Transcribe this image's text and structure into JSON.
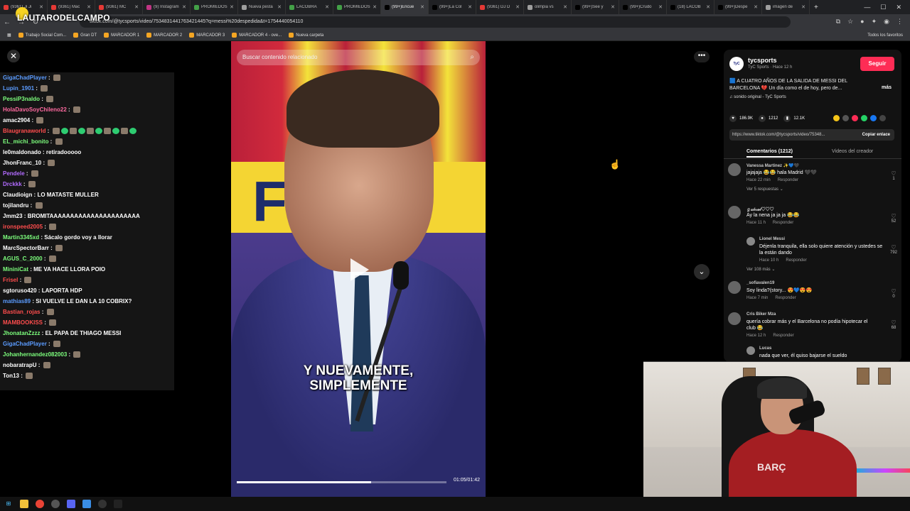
{
  "browser": {
    "tabs": [
      {
        "title": "(9361) Ji Ji",
        "color": "#e53935"
      },
      {
        "title": "(9361) Mac",
        "color": "#e53935"
      },
      {
        "title": "(9361) MC",
        "color": "#e53935"
      },
      {
        "title": "(9) Instagram",
        "color": "#c13584"
      },
      {
        "title": "PROMIEDOS",
        "color": "#43a047"
      },
      {
        "title": "Nueva pesta",
        "color": "#9e9e9e"
      },
      {
        "title": "LACOBRA",
        "color": "#43a047"
      },
      {
        "title": "PROMIEDOS",
        "color": "#43a047"
      },
      {
        "title": "(99+)Encue",
        "color": "#000000"
      },
      {
        "title": "(99+)La Col",
        "color": "#000000"
      },
      {
        "title": "(9361) DJ D",
        "color": "#e53935"
      },
      {
        "title": "olimpia vs",
        "color": "#9e9e9e"
      },
      {
        "title": "(99+)See y",
        "color": "#000000"
      },
      {
        "title": "(99+)Crudo",
        "color": "#000000"
      },
      {
        "title": "(18) LACOB",
        "color": "#000000"
      },
      {
        "title": "(99+)Despe",
        "color": "#000000"
      },
      {
        "title": "imagen de",
        "color": "#9e9e9e"
      }
    ],
    "active_tab_index": 8,
    "url": "tiktok.com/@tycsports/video/7534831441763421445?q=messi%20despedida&t=1754440054110",
    "bookmarks": [
      "Trabajo Social Com...",
      "Gran DT",
      "MARCADOR 1",
      "MARCADOR 2",
      "MARCADOR 3",
      "MARCADOR 4 - ove...",
      "Nueva carpeta"
    ],
    "bookmarks_right": "Todos los favoritos",
    "overlay_logo": "LAUTARODELCAMPO"
  },
  "chat": {
    "messages": [
      {
        "user": "GigaChadPlayer",
        "color": "#5b9cff",
        "text": "",
        "emotes": 1
      },
      {
        "user": "Lupin_1901",
        "color": "#5b9cff",
        "text": "",
        "emotes": 1
      },
      {
        "user": "PessiP3naldo",
        "color": "#7dff7d",
        "text": "",
        "emotes": 1
      },
      {
        "user": "HolaDavoSoyChileno22",
        "color": "#ff6aa0",
        "text": "",
        "emotes": 1
      },
      {
        "user": "amac2904",
        "color": "#ffffff",
        "text": "",
        "emotes": 1
      },
      {
        "user": "Blaugranaworld",
        "color": "#ff4d4d",
        "text": "",
        "emotes": 10
      },
      {
        "user": "EL_michi_bonito",
        "color": "#7dff7d",
        "text": "",
        "emotes": 1
      },
      {
        "user": "le0maldonado",
        "color": "#ffffff",
        "text": "retiradooooo",
        "emotes": 0
      },
      {
        "user": "JhonFranc_10",
        "color": "#ffffff",
        "text": "",
        "emotes": 1
      },
      {
        "user": "Pendele",
        "color": "#b26bff",
        "text": "",
        "emotes": 1
      },
      {
        "user": "Drckkk",
        "color": "#b26bff",
        "text": "",
        "emotes": 1
      },
      {
        "user": "Claudioign",
        "color": "#ffffff",
        "text": "LO MATASTE MULLER",
        "emotes": 0
      },
      {
        "user": "tojilandru",
        "color": "#ffffff",
        "text": "",
        "emotes": 1
      },
      {
        "user": "Jmm23",
        "color": "#ffffff",
        "text": "BROMITAAAAAAAAAAAAAAAAAAAAAA",
        "emotes": 0
      },
      {
        "user": "ironspeed2005",
        "color": "#ff4d4d",
        "text": "",
        "emotes": 1
      },
      {
        "user": "Martin3345xd",
        "color": "#7dff7d",
        "text": "Sácalo gordo voy a llorar",
        "emotes": 0
      },
      {
        "user": "MarcSpectorBarr",
        "color": "#ffffff",
        "text": "",
        "emotes": 1
      },
      {
        "user": "AGUS_C_2000",
        "color": "#7dff7d",
        "text": "",
        "emotes": 1
      },
      {
        "user": "MininiCat",
        "color": "#7dff7d",
        "text": "ME VA HACE LLORA POIO",
        "emotes": 0
      },
      {
        "user": "Frisel",
        "color": "#ff4d4d",
        "text": "",
        "emotes": 1
      },
      {
        "user": "sgtoruso420",
        "color": "#ffffff",
        "text": "LAPORTA HDP",
        "emotes": 0
      },
      {
        "user": "mathias89",
        "color": "#5b9cff",
        "text": "SI VUELVE LE DAN LA 10 COBRIX?",
        "emotes": 0
      },
      {
        "user": "Bastian_rojas",
        "color": "#ff4d4d",
        "text": "",
        "emotes": 1
      },
      {
        "user": "MAMBOOKISS",
        "color": "#ff4d4d",
        "text": "",
        "emotes": 1
      },
      {
        "user": "JhonatanZzzz",
        "color": "#7dff7d",
        "text": "EL PAPA DE THIAGO MESSI",
        "emotes": 0
      },
      {
        "user": "GigaChadPlayer",
        "color": "#5b9cff",
        "text": "",
        "emotes": 1
      },
      {
        "user": "Johanhernandez082003",
        "color": "#7dff7d",
        "text": "",
        "emotes": 1
      },
      {
        "user": "nobaratrapU",
        "color": "#ffffff",
        "text": "",
        "emotes": 1
      },
      {
        "user": "Ton13",
        "color": "#ffffff",
        "text": "",
        "emotes": 1
      }
    ]
  },
  "video": {
    "search_placeholder": "Buscar contenido relacionado",
    "subtitle_line1": "Y NUEVAMENTE,",
    "subtitle_line2": "SIMPLEMENTE",
    "time": "01:05/01:42",
    "progress": 0.64,
    "bg_letter": "F"
  },
  "panel": {
    "account_name": "tycsports",
    "account_sub": "TyC Sports · Hace 12 h",
    "follow_label": "Seguir",
    "description": "🟦 A CUATRO AÑOS DE LA SALIDA DE MESSI DEL BARCELONA 💔 Un día como el de hoy, pero de...",
    "more_label": "más",
    "sound": "♫ sonido original - TyC Sports",
    "likes": "186.9K",
    "comments": "1212",
    "saves": "12.1K",
    "link": "https://www.tiktok.com/@tycsports/video/75348...",
    "copy_label": "Copiar enlace",
    "tab_comments": "Comentarios (1212)",
    "tab_creator": "Videos del creador",
    "comment_list": [
      {
        "name": "Vanessa Martinez ✨💙🖤",
        "text": "jajajaja 😂😂 hala Madrid 🖤🖤",
        "time": "Hace 22 min",
        "reply": "Responder",
        "likes": "1",
        "replies": "Ver 5 respuestas ⌄"
      },
      {
        "name": "ℊ𝒶𝒷𝓇𝒾ℯ𝓁♡♡♡",
        "text": "Ay la nena ja ja ja 😂😂",
        "time": "Hace 11 h",
        "reply": "Responder",
        "likes": "52",
        "replies": ""
      },
      {
        "name": "Lionel Messi",
        "text": "Déjenla tranquila, ella solo quiere atención y ustedes se la están dando",
        "time": "Hace 10 h",
        "reply": "Responder",
        "likes": "792",
        "replies": "Ver 108 más ⌄"
      },
      {
        "name": "_sofiavalen19",
        "text": "Soy linda?(story... 😍💙😍😍",
        "time": "Hace 7 min",
        "reply": "Responder",
        "likes": "0",
        "replies": ""
      },
      {
        "name": "Cris Biker Mza",
        "text": "quería cobrar más y el Barcelona no podía hipotecar el club 😂",
        "time": "Hace 12 h",
        "reply": "Responder",
        "likes": "68",
        "replies": ""
      },
      {
        "name": "Lucas",
        "text": "nada que ver, él quiso bajarse el sueldo",
        "time": "",
        "reply": "",
        "likes": "",
        "replies": ""
      }
    ]
  },
  "webcam": {
    "shirt_text": "BARÇ"
  }
}
